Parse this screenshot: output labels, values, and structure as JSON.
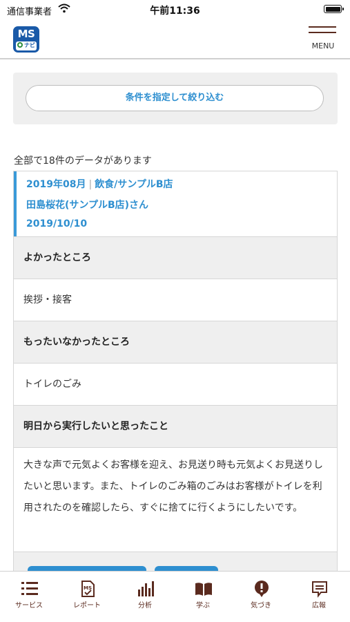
{
  "status_bar": {
    "carrier": "通信事業者",
    "time": "午前11:36"
  },
  "header": {
    "logo_text": "MS",
    "logo_sub": "ナビ",
    "menu_label": "MENU"
  },
  "filter": {
    "button_label": "条件を指定して絞り込む"
  },
  "results": {
    "count_text": "全部で18件のデータがあります"
  },
  "record": {
    "period": "2019年08月",
    "shop": "飲食/サンプルB店",
    "person": "田島桜花(サンプルB店)さん",
    "date": "2019/10/10",
    "sections": [
      {
        "heading": "よかったところ",
        "body": "挨拶・接客"
      },
      {
        "heading": "もったいなかったところ",
        "body": "トイレのごみ"
      },
      {
        "heading": "明日から実行したいと思ったこと",
        "body": "大きな声で元気よくお客様を迎え、お見送り時も元気よくお見送りしたいと思います。また、トイレのごみ箱のごみはお客様がトイレを利用されたのを確認したら、すぐに捨てに行くようにしたいです。"
      }
    ]
  },
  "tabs": [
    {
      "label": "サービス",
      "icon": "list-icon"
    },
    {
      "label": "レポート",
      "icon": "report-icon"
    },
    {
      "label": "分析",
      "icon": "bar-chart-icon"
    },
    {
      "label": "学ぶ",
      "icon": "book-icon"
    },
    {
      "label": "気づき",
      "icon": "exclamation-bubble-icon"
    },
    {
      "label": "広報",
      "icon": "message-icon"
    }
  ],
  "colors": {
    "accent": "#2e8fd0",
    "brand_brown": "#5a2a1e",
    "logo_blue": "#1a5aa8"
  }
}
